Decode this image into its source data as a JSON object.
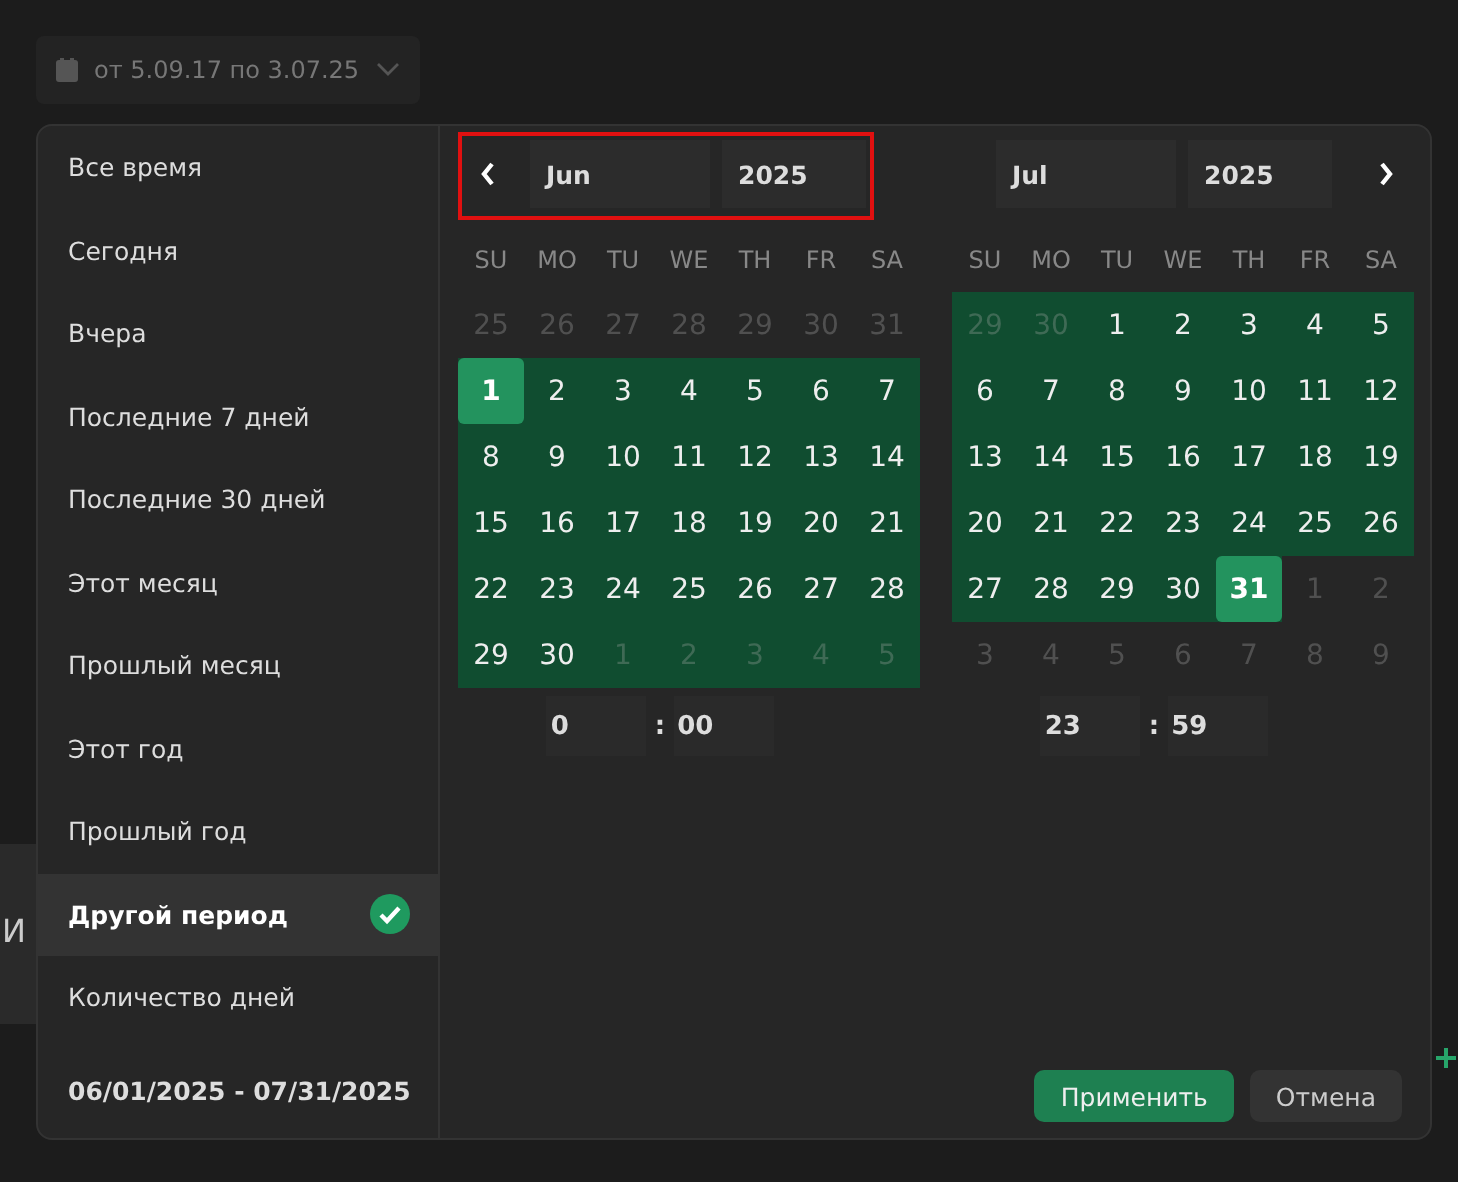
{
  "range_button": {
    "label": "от 5.09.17 по 3.07.25"
  },
  "background": {
    "fragment": "И"
  },
  "presets": [
    {
      "label": "Все время",
      "selected": false
    },
    {
      "label": "Сегодня",
      "selected": false
    },
    {
      "label": "Вчера",
      "selected": false
    },
    {
      "label": "Последние 7 дней",
      "selected": false
    },
    {
      "label": "Последние 30 дней",
      "selected": false
    },
    {
      "label": "Этот месяц",
      "selected": false
    },
    {
      "label": "Прошлый месяц",
      "selected": false
    },
    {
      "label": "Этот год",
      "selected": false
    },
    {
      "label": "Прошлый год",
      "selected": false
    },
    {
      "label": "Другой период",
      "selected": true
    },
    {
      "label": "Количество дней",
      "selected": false
    }
  ],
  "range_summary": "06/01/2025 - 07/31/2025",
  "calendars": [
    {
      "kind": "prev",
      "highlighted": true,
      "month": "Jun",
      "year": "2025",
      "weekdays": [
        "SU",
        "MO",
        "TU",
        "WE",
        "TH",
        "FR",
        "SA"
      ],
      "weeks": [
        [
          {
            "text": "25",
            "muted": true,
            "in_range": false,
            "selected": false
          },
          {
            "text": "26",
            "muted": true,
            "in_range": false,
            "selected": false
          },
          {
            "text": "27",
            "muted": true,
            "in_range": false,
            "selected": false
          },
          {
            "text": "28",
            "muted": true,
            "in_range": false,
            "selected": false
          },
          {
            "text": "29",
            "muted": true,
            "in_range": false,
            "selected": false
          },
          {
            "text": "30",
            "muted": true,
            "in_range": false,
            "selected": false
          },
          {
            "text": "31",
            "muted": true,
            "in_range": false,
            "selected": false
          }
        ],
        [
          {
            "text": "1",
            "muted": false,
            "in_range": true,
            "selected": true
          },
          {
            "text": "2",
            "muted": false,
            "in_range": true,
            "selected": false
          },
          {
            "text": "3",
            "muted": false,
            "in_range": true,
            "selected": false
          },
          {
            "text": "4",
            "muted": false,
            "in_range": true,
            "selected": false
          },
          {
            "text": "5",
            "muted": false,
            "in_range": true,
            "selected": false
          },
          {
            "text": "6",
            "muted": false,
            "in_range": true,
            "selected": false
          },
          {
            "text": "7",
            "muted": false,
            "in_range": true,
            "selected": false
          }
        ],
        [
          {
            "text": "8",
            "muted": false,
            "in_range": true,
            "selected": false
          },
          {
            "text": "9",
            "muted": false,
            "in_range": true,
            "selected": false
          },
          {
            "text": "10",
            "muted": false,
            "in_range": true,
            "selected": false
          },
          {
            "text": "11",
            "muted": false,
            "in_range": true,
            "selected": false
          },
          {
            "text": "12",
            "muted": false,
            "in_range": true,
            "selected": false
          },
          {
            "text": "13",
            "muted": false,
            "in_range": true,
            "selected": false
          },
          {
            "text": "14",
            "muted": false,
            "in_range": true,
            "selected": false
          }
        ],
        [
          {
            "text": "15",
            "muted": false,
            "in_range": true,
            "selected": false
          },
          {
            "text": "16",
            "muted": false,
            "in_range": true,
            "selected": false
          },
          {
            "text": "17",
            "muted": false,
            "in_range": true,
            "selected": false
          },
          {
            "text": "18",
            "muted": false,
            "in_range": true,
            "selected": false
          },
          {
            "text": "19",
            "muted": false,
            "in_range": true,
            "selected": false
          },
          {
            "text": "20",
            "muted": false,
            "in_range": true,
            "selected": false
          },
          {
            "text": "21",
            "muted": false,
            "in_range": true,
            "selected": false
          }
        ],
        [
          {
            "text": "22",
            "muted": false,
            "in_range": true,
            "selected": false
          },
          {
            "text": "23",
            "muted": false,
            "in_range": true,
            "selected": false
          },
          {
            "text": "24",
            "muted": false,
            "in_range": true,
            "selected": false
          },
          {
            "text": "25",
            "muted": false,
            "in_range": true,
            "selected": false
          },
          {
            "text": "26",
            "muted": false,
            "in_range": true,
            "selected": false
          },
          {
            "text": "27",
            "muted": false,
            "in_range": true,
            "selected": false
          },
          {
            "text": "28",
            "muted": false,
            "in_range": true,
            "selected": false
          }
        ],
        [
          {
            "text": "29",
            "muted": false,
            "in_range": true,
            "selected": false
          },
          {
            "text": "30",
            "muted": false,
            "in_range": true,
            "selected": false
          },
          {
            "text": "1",
            "muted": true,
            "in_range": true,
            "selected": false
          },
          {
            "text": "2",
            "muted": true,
            "in_range": true,
            "selected": false
          },
          {
            "text": "3",
            "muted": true,
            "in_range": true,
            "selected": false
          },
          {
            "text": "4",
            "muted": true,
            "in_range": true,
            "selected": false
          },
          {
            "text": "5",
            "muted": true,
            "in_range": true,
            "selected": false
          }
        ]
      ],
      "hours": "0",
      "minutes": "00",
      "separator": ":"
    },
    {
      "kind": "next",
      "month": "Jul",
      "year": "2025",
      "weekdays": [
        "SU",
        "MO",
        "TU",
        "WE",
        "TH",
        "FR",
        "SA"
      ],
      "weeks": [
        [
          {
            "text": "29",
            "muted": true,
            "in_range": true,
            "selected": false
          },
          {
            "text": "30",
            "muted": true,
            "in_range": true,
            "selected": false
          },
          {
            "text": "1",
            "muted": false,
            "in_range": true,
            "selected": false
          },
          {
            "text": "2",
            "muted": false,
            "in_range": true,
            "selected": false
          },
          {
            "text": "3",
            "muted": false,
            "in_range": true,
            "selected": false
          },
          {
            "text": "4",
            "muted": false,
            "in_range": true,
            "selected": false
          },
          {
            "text": "5",
            "muted": false,
            "in_range": true,
            "selected": false
          }
        ],
        [
          {
            "text": "6",
            "muted": false,
            "in_range": true,
            "selected": false
          },
          {
            "text": "7",
            "muted": false,
            "in_range": true,
            "selected": false
          },
          {
            "text": "8",
            "muted": false,
            "in_range": true,
            "selected": false
          },
          {
            "text": "9",
            "muted": false,
            "in_range": true,
            "selected": false
          },
          {
            "text": "10",
            "muted": false,
            "in_range": true,
            "selected": false
          },
          {
            "text": "11",
            "muted": false,
            "in_range": true,
            "selected": false
          },
          {
            "text": "12",
            "muted": false,
            "in_range": true,
            "selected": false
          }
        ],
        [
          {
            "text": "13",
            "muted": false,
            "in_range": true,
            "selected": false
          },
          {
            "text": "14",
            "muted": false,
            "in_range": true,
            "selected": false
          },
          {
            "text": "15",
            "muted": false,
            "in_range": true,
            "selected": false
          },
          {
            "text": "16",
            "muted": false,
            "in_range": true,
            "selected": false
          },
          {
            "text": "17",
            "muted": false,
            "in_range": true,
            "selected": false
          },
          {
            "text": "18",
            "muted": false,
            "in_range": true,
            "selected": false
          },
          {
            "text": "19",
            "muted": false,
            "in_range": true,
            "selected": false
          }
        ],
        [
          {
            "text": "20",
            "muted": false,
            "in_range": true,
            "selected": false
          },
          {
            "text": "21",
            "muted": false,
            "in_range": true,
            "selected": false
          },
          {
            "text": "22",
            "muted": false,
            "in_range": true,
            "selected": false
          },
          {
            "text": "23",
            "muted": false,
            "in_range": true,
            "selected": false
          },
          {
            "text": "24",
            "muted": false,
            "in_range": true,
            "selected": false
          },
          {
            "text": "25",
            "muted": false,
            "in_range": true,
            "selected": false
          },
          {
            "text": "26",
            "muted": false,
            "in_range": true,
            "selected": false
          }
        ],
        [
          {
            "text": "27",
            "muted": false,
            "in_range": true,
            "selected": false
          },
          {
            "text": "28",
            "muted": false,
            "in_range": true,
            "selected": false
          },
          {
            "text": "29",
            "muted": false,
            "in_range": true,
            "selected": false
          },
          {
            "text": "30",
            "muted": false,
            "in_range": true,
            "selected": false
          },
          {
            "text": "31",
            "muted": false,
            "in_range": true,
            "selected": true
          },
          {
            "text": "1",
            "muted": true,
            "in_range": false,
            "selected": false
          },
          {
            "text": "2",
            "muted": true,
            "in_range": false,
            "selected": false
          }
        ],
        [
          {
            "text": "3",
            "muted": true,
            "in_range": false,
            "selected": false
          },
          {
            "text": "4",
            "muted": true,
            "in_range": false,
            "selected": false
          },
          {
            "text": "5",
            "muted": true,
            "in_range": false,
            "selected": false
          },
          {
            "text": "6",
            "muted": true,
            "in_range": false,
            "selected": false
          },
          {
            "text": "7",
            "muted": true,
            "in_range": false,
            "selected": false
          },
          {
            "text": "8",
            "muted": true,
            "in_range": false,
            "selected": false
          },
          {
            "text": "9",
            "muted": true,
            "in_range": false,
            "selected": false
          }
        ]
      ],
      "hours": "23",
      "minutes": "59",
      "separator": ":"
    }
  ],
  "buttons": [
    {
      "label": "Применить",
      "kind": "primary"
    },
    {
      "label": "Отмена",
      "kind": "secondary"
    }
  ]
}
